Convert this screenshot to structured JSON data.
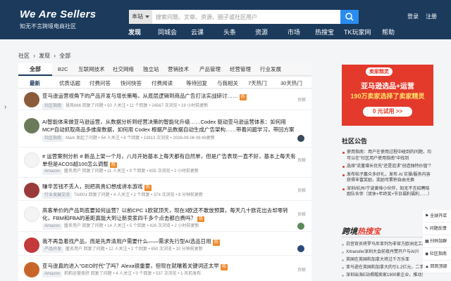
{
  "header": {
    "logo_title": "We Are Sellers",
    "logo_subtitle": "知无不言跨境电商社区",
    "search_scope": "本站",
    "search_placeholder": "搜索问题、文章、资源、圈子或社区用户",
    "login_label": "登录",
    "register_label": "注册",
    "nav": [
      "发现",
      "同城会",
      "云课",
      "头条",
      "资源",
      "市场",
      "热搜宝",
      "TK玩家网",
      "帮助"
    ],
    "active_nav": "发现"
  },
  "breadcrumb": [
    "社区",
    "›",
    "发现",
    "›",
    "全部"
  ],
  "category_tabs": [
    "全部",
    "B2C",
    "互联网技术",
    "社交网络",
    "独立站",
    "营销技术",
    "产品管理",
    "经营管理",
    "行业发展"
  ],
  "sort_tabs": [
    "最新",
    "优质话题",
    "付费问答",
    "快问快答",
    "付费阅读",
    "等待回复",
    "与我相关",
    "7天热门",
    "30天热门"
  ],
  "posts": [
    {
      "title": "亚马逊运营视角下的产品开发与增长策略，从底层逻辑到商品广告打法实战研讨……",
      "hot": "热",
      "tag": "社区指南",
      "meta": "慧风666 回复了问题 • 50 人关注 • 11 个回复 • 24567 次浏览 • 19 小时前更新",
      "right": "贡献"
    },
    {
      "title": "AI智能体来做亚马逊运营，从数据分析到经营决策的智能化升级……Codex 驱动亚马逊运营体系：如何用MCP自动抓取商品多维度数据，如何用 Codex 根据产品数据自动生成广告架构……带着问题学习，带回方案落地",
      "hot": "热",
      "tag": "社区指南",
      "meta": "Mark 发起了问题 • 54 人关注 • 8 个回复 • 13813 次浏览 • 2026-09-06 09:49更新",
      "right": ""
    },
    {
      "title": "# 运营案例分析 # 新品上架一个月，八月开始基本上每天都有自然单，但是广告表现一直不好，基本上每天有单但是ACOS超100怎么调整",
      "hot": "热",
      "tag": "Amazon",
      "meta": "匿名用户 回复了问题 • 11 人关注 • 9 个回复 • 835 次浏览 • 2 小时前更新",
      "right": "贡献"
    },
    {
      "title": "赚辛苦钱不丢人，别把高贵幻想成讲本游戏",
      "hot": "热",
      "tag": "行业发展交流",
      "meta": "TAI001 回复了问题 • 4 人关注 • 2 个回复 • 374 次浏览 • 8 分钟前更新",
      "right": "贡献"
    },
    {
      "title": "高客单价的产品到底要如何运营？以前CPC 1欧就顶天，现在3欧还不敢放预算，每天几十欧花出去却零转化，FBM和FBA的差距真能大到让新卖家四千多个点击都白费吗？",
      "hot": "热",
      "tag": "Amazon",
      "meta": "匿名用户 回复了问题 • 14 人关注 • 5 个回复 • 426 次浏览 • 2 小时前更新",
      "right": "贡献"
    },
    {
      "title": "我不再急着找产品，而是先弄清用户需要什么——需求先行型AI选品日用",
      "hot": "热",
      "tag": "产品开发",
      "meta": "匿名用户 回复了问题 • 12 人关注 • 2 个回复 • 650 次浏览 • 10 分钟前更新",
      "right": ""
    },
    {
      "title": "亚马逊真的进入\"GEO时代\"了吗？Alexa很重要，但现在就嚷着关键词还太早",
      "hot": "热",
      "tag": "Amazon",
      "meta": "莉莉运营卖肝 回复了问题 • 4 人关注 • 0 个回复 • 537 次浏览 • 1 天前发布",
      "right": "贡献"
    }
  ],
  "ad": {
    "badge": "卖家精灵",
    "line1": "亚马逊选品+运营",
    "line2": "190万卖家选择了卖家精灵",
    "button": "0 元试用 >>"
  },
  "notice": {
    "heading": "社区公告",
    "items": [
      "使用指南：用户在使用过程中碰到的问题，均可以在\"社区用户使用指南\"中找到",
      "选择\"流量增长优先\"还是追求\"创造独特价值\"？",
      "发布帖子赢众多好礼，发布 AI 实操/服务内容获得丰富奖励，奖励可累积自由兑换",
      "深圳/杭州/宁波黄埠小伙伴，知无不言招聘陪跑队伙伴（双休+年终奖+节日福利福利……）"
    ]
  },
  "hotsearch": {
    "title_part1": "跨境",
    "title_part2": "热搜宝",
    "items": [
      "白宫官员将罗马尼亚列为非官方欧洲北工厂之一",
      "X/transfer深圳大会前夜丹赞开户与AI兴",
      "英国在英国和加拿大将过千万乐亚",
      "亚马逊在英国和加拿大的引1.2亿元，二手车出",
      "深圳出海E站揭帽卖家1900家企业，推动实……"
    ]
  },
  "floating": [
    "全球开店",
    "问题反馈",
    "扫码加群",
    "社区指南",
    "回到顶部"
  ]
}
